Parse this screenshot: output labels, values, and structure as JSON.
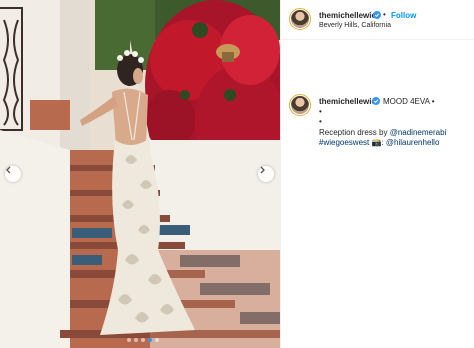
{
  "post": {
    "username": "themichellewie",
    "location": "Beverly Hills, California",
    "follow_label": "Follow",
    "separator": "•",
    "caption": {
      "text_main": "MOOD 4EVA •",
      "bullet_1": "•",
      "bullet_2": "•",
      "line1_prefix": "Reception dress by ",
      "line1_mention": "@nadinemerabi",
      "line2_hashtag": "#wiegoeswest",
      "line2_emoji": "📸",
      "line2_colon": ": ",
      "line2_mention": "@hilaurenhello"
    }
  },
  "carousel": {
    "total_slides": 5,
    "active_index": 4
  },
  "colors": {
    "accent": "#0095f6",
    "verified": "#3897f0",
    "link": "#00376b",
    "bougainvillea": "#c2182c",
    "tile": "#b86a4e"
  },
  "icons": {
    "prev": "chevron-left-icon",
    "next": "chevron-right-icon",
    "verified": "verified-badge-icon"
  }
}
